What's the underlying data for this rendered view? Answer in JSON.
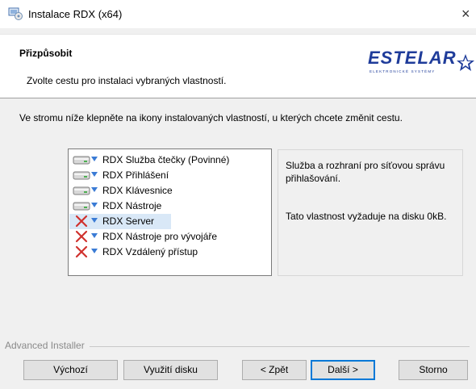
{
  "window": {
    "title": "Instalace RDX (x64)",
    "close": "×"
  },
  "banner": {
    "title": "Přizpůsobit",
    "subtitle": "Zvolte cestu pro instalaci vybraných vlastností.",
    "logo_text": "ESTELAR",
    "logo_tagline": "ELEKTRONICKÉ SYSTÉMY"
  },
  "instruction": "Ve stromu níže klepněte na ikony instalovaných vlastností, u kterých chcete změnit cestu.",
  "tree": {
    "items": [
      {
        "label": "RDX Služba čtečky (Povinné)",
        "icon": "drive-icon",
        "state": "installed"
      },
      {
        "label": "RDX Přihlášení",
        "icon": "drive-icon",
        "state": "installed"
      },
      {
        "label": "RDX Klávesnice",
        "icon": "drive-icon",
        "state": "installed"
      },
      {
        "label": "RDX Nástroje",
        "icon": "drive-icon",
        "state": "installed"
      },
      {
        "label": "RDX Server",
        "icon": "not-installed-icon",
        "state": "not-installed",
        "selected": true
      },
      {
        "label": "RDX Nástroje pro vývojáře",
        "icon": "not-installed-icon",
        "state": "not-installed"
      },
      {
        "label": "RDX Vzdálený přístup",
        "icon": "not-installed-icon",
        "state": "not-installed"
      }
    ]
  },
  "description": {
    "text": "Služba a rozhraní pro síťovou správu přihlašování.",
    "size_info": "Tato vlastnost vyžaduje na disku 0kB."
  },
  "footer": {
    "brand": "Advanced Installer"
  },
  "buttons": {
    "reset": "Výchozí",
    "disk_usage": "Využití disku",
    "back": "< Zpět",
    "next": "Další >",
    "cancel": "Storno"
  },
  "colors": {
    "accent": "#0078d7",
    "logo_blue": "#1f3c9a",
    "selection": "#d9e8f7",
    "error_red": "#d0312d"
  }
}
